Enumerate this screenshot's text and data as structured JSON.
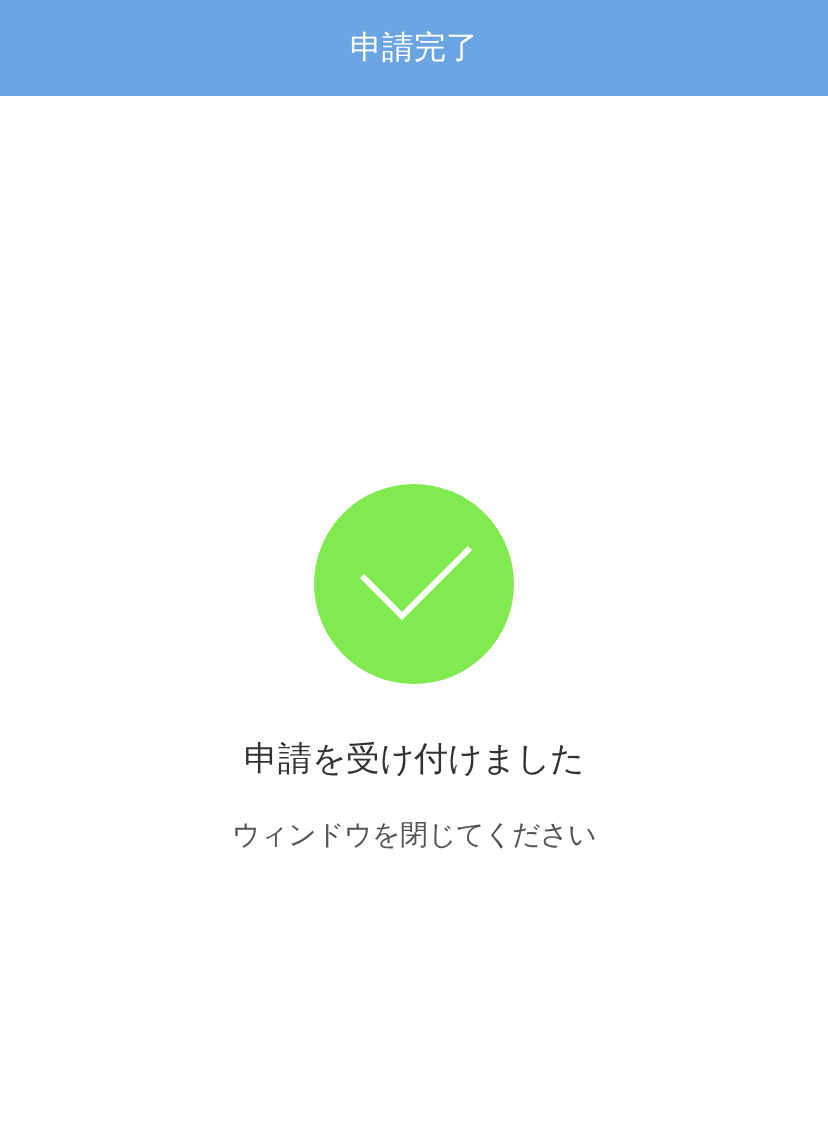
{
  "header": {
    "title": "申請完了"
  },
  "message": {
    "title": "申請を受け付けました",
    "subtitle": "ウィンドウを閉じてください"
  }
}
